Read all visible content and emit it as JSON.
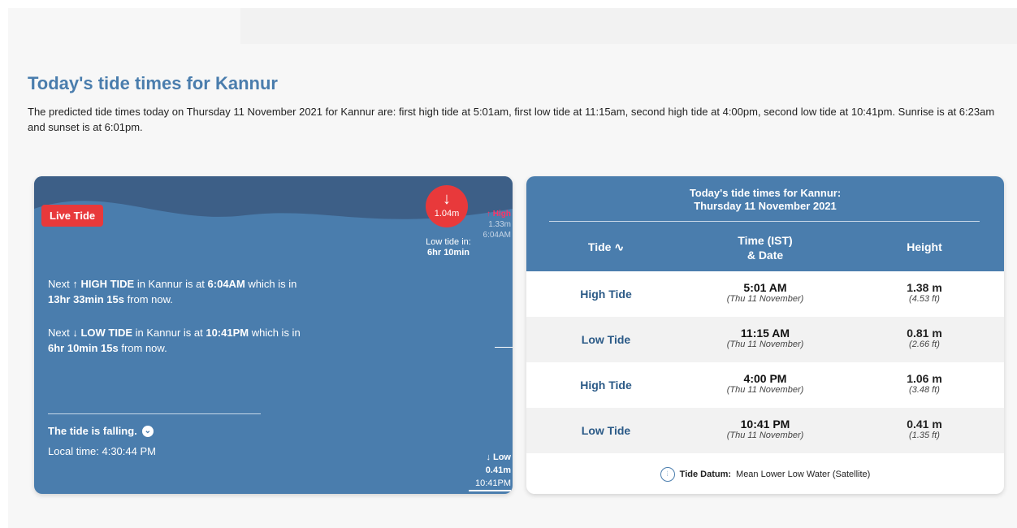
{
  "heading": "Today's tide times for Kannur",
  "summary": "The predicted tide times today on Thursday 11 November 2021 for Kannur are: first high tide at 5:01am, first low tide at 11:15am, second high tide at 4:00pm, second low tide at 10:41pm. Sunrise is at 6:23am and sunset is at 6:01pm.",
  "live": {
    "badge": "Live Tide",
    "current_arrow": "↓",
    "current_height": "1.04m",
    "low_in_label": "Low tide in:",
    "low_in_value": "6hr 10min",
    "high_marker": {
      "label": "↑ High",
      "height": "1.33m",
      "time": "6:04AM"
    },
    "next_high": {
      "prefix": "Next ↑",
      "type": "HIGH TIDE",
      "mid": " in Kannur is at ",
      "time": "6:04AM",
      "suffix": " which is in ",
      "duration": "13hr 33min 15s",
      "end": " from now."
    },
    "next_low": {
      "prefix": "Next ↓",
      "type": "LOW TIDE",
      "mid": " in Kannur is at ",
      "time": "10:41PM",
      "suffix": " which is in ",
      "duration": "6hr 10min 15s",
      "end": " from now."
    },
    "falling_text": "The tide is falling.",
    "falling_icon": "chevron-down-circle-icon",
    "local_time": "Local time: 4:30:44 PM",
    "low_marker": {
      "label": "↓ Low",
      "height": "0.41m",
      "time": "10:41PM"
    }
  },
  "table": {
    "title_line1": "Today's tide times for Kannur:",
    "title_line2": "Thursday 11 November 2021",
    "col_tide": "Tide",
    "col_time_line1": "Time (IST)",
    "col_time_line2": "& Date",
    "col_height": "Height",
    "rows": [
      {
        "type": "High Tide",
        "time": "5:01 AM",
        "date": "(Thu 11 November)",
        "height_m": "1.38 m",
        "height_ft": "(4.53 ft)"
      },
      {
        "type": "Low Tide",
        "time": "11:15 AM",
        "date": "(Thu 11 November)",
        "height_m": "0.81 m",
        "height_ft": "(2.66 ft)"
      },
      {
        "type": "High Tide",
        "time": "4:00 PM",
        "date": "(Thu 11 November)",
        "height_m": "1.06 m",
        "height_ft": "(3.48 ft)"
      },
      {
        "type": "Low Tide",
        "time": "10:41 PM",
        "date": "(Thu 11 November)",
        "height_m": "0.41 m",
        "height_ft": "(1.35 ft)"
      }
    ],
    "datum_label": "Tide Datum:",
    "datum_value": "Mean Lower Low Water (Satellite)"
  },
  "colors": {
    "accent": "#4a7dad",
    "alert": "#e8393b"
  }
}
